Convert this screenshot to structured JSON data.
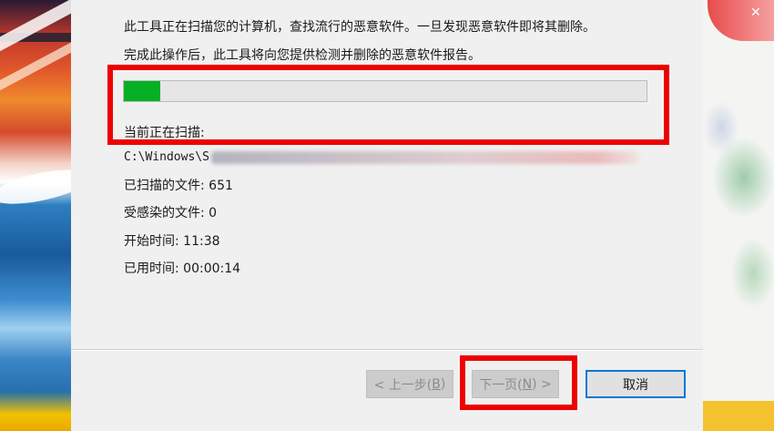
{
  "dialog": {
    "description_line1": "此工具正在扫描您的计算机，查找流行的恶意软件。一旦发现恶意软件即将其删除。",
    "description_line2": "完成此操作后，此工具将向您提供检测并删除的恶意软件报告。",
    "progress_percent": 7,
    "scanning_label": "当前正在扫描:",
    "scanning_path_visible": "C:\\Windows\\S",
    "stats": {
      "scanned_files": "已扫描的文件: 651",
      "infected_files": "受感染的文件: 0",
      "start_time": "开始时间: 11:38",
      "elapsed_time": "已用时间: 00:00:14"
    },
    "buttons": {
      "back_prefix": "< 上一步(",
      "back_key": "B",
      "back_suffix": ")",
      "next_prefix": "下一页(",
      "next_key": "N",
      "next_suffix": ") >",
      "cancel": "取消"
    }
  },
  "colors": {
    "progress_fill": "#06b025",
    "annotation_red": "#ee0000",
    "cancel_border": "#0078d7"
  }
}
